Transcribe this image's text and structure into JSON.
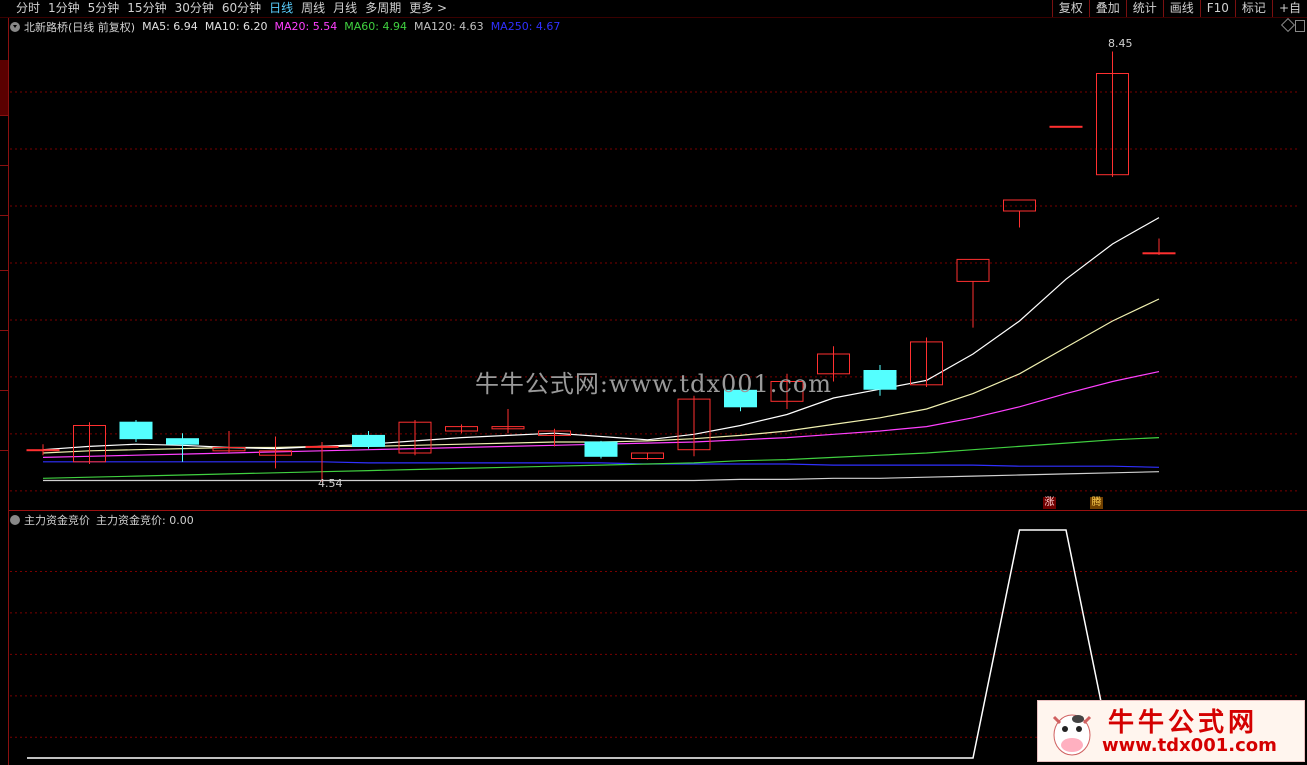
{
  "toolbar": {
    "tabs": [
      {
        "label": "分时",
        "active": false
      },
      {
        "label": "1分钟",
        "active": false
      },
      {
        "label": "5分钟",
        "active": false
      },
      {
        "label": "15分钟",
        "active": false
      },
      {
        "label": "30分钟",
        "active": false
      },
      {
        "label": "60分钟",
        "active": false
      },
      {
        "label": "日线",
        "active": true
      },
      {
        "label": "周线",
        "active": false
      },
      {
        "label": "月线",
        "active": false
      },
      {
        "label": "多周期",
        "active": false
      },
      {
        "label": "更多 >",
        "active": false
      }
    ],
    "right_buttons": [
      "复权",
      "叠加",
      "统计",
      "画线",
      "F10",
      "标记",
      "+自"
    ]
  },
  "main_legend": {
    "title": "北新路桥(日线 前复权)",
    "ma": [
      {
        "label": "MA5: 6.94",
        "color": "#e0e0e0"
      },
      {
        "label": "MA10: 6.20",
        "color": "#e0e0e0"
      },
      {
        "label": "MA20: 5.54",
        "color": "#ff40ff"
      },
      {
        "label": "MA60: 4.94",
        "color": "#40d040"
      },
      {
        "label": "MA120: 4.63",
        "color": "#c0c0c0"
      },
      {
        "label": "MA250: 4.67",
        "color": "#3030ff"
      }
    ]
  },
  "indicator_legend": {
    "name": "主力资金竞价",
    "value_label": "主力资金竞价: 0.00"
  },
  "watermark": "牛牛公式网:www.tdx001.com",
  "logo": {
    "line1": "牛牛公式网",
    "line2": "www.tdx001.com"
  },
  "badges": {
    "zhang": "涨",
    "teng": "腾"
  },
  "colors": {
    "up": "#ff3030",
    "down": "#54ffff",
    "grid": "#7a0000",
    "bg": "#000000"
  },
  "chart_data": {
    "type": "candlestick",
    "price_range": [
      4.3,
      8.6
    ],
    "high_label": "8.45",
    "low_label": "4.54",
    "candles": [
      {
        "o": 4.83,
        "h": 4.88,
        "l": 4.78,
        "c": 4.83
      },
      {
        "o": 4.72,
        "h": 5.08,
        "l": 4.7,
        "c": 5.05
      },
      {
        "o": 5.08,
        "h": 5.1,
        "l": 4.9,
        "c": 4.93
      },
      {
        "o": 4.93,
        "h": 4.98,
        "l": 4.72,
        "c": 4.88
      },
      {
        "o": 4.82,
        "h": 5.0,
        "l": 4.8,
        "c": 4.85
      },
      {
        "o": 4.78,
        "h": 4.95,
        "l": 4.66,
        "c": 4.82
      },
      {
        "o": 4.86,
        "h": 4.9,
        "l": 4.54,
        "c": 4.86
      },
      {
        "o": 4.96,
        "h": 5.0,
        "l": 4.84,
        "c": 4.86
      },
      {
        "o": 4.8,
        "h": 5.1,
        "l": 4.78,
        "c": 5.08
      },
      {
        "o": 5.0,
        "h": 5.06,
        "l": 4.98,
        "c": 5.04
      },
      {
        "o": 5.02,
        "h": 5.2,
        "l": 4.98,
        "c": 5.04
      },
      {
        "o": 4.96,
        "h": 5.02,
        "l": 4.86,
        "c": 5.0
      },
      {
        "o": 4.9,
        "h": 4.91,
        "l": 4.75,
        "c": 4.77
      },
      {
        "o": 4.75,
        "h": 4.8,
        "l": 4.74,
        "c": 4.8
      },
      {
        "o": 4.83,
        "h": 5.32,
        "l": 4.77,
        "c": 5.29
      },
      {
        "o": 5.37,
        "h": 5.43,
        "l": 5.18,
        "c": 5.22
      },
      {
        "o": 5.27,
        "h": 5.52,
        "l": 5.2,
        "c": 5.45
      },
      {
        "o": 5.52,
        "h": 5.77,
        "l": 5.45,
        "c": 5.7
      },
      {
        "o": 5.55,
        "h": 5.6,
        "l": 5.32,
        "c": 5.38
      },
      {
        "o": 5.42,
        "h": 5.85,
        "l": 5.4,
        "c": 5.81
      },
      {
        "o": 6.36,
        "h": 6.36,
        "l": 5.94,
        "c": 6.56
      },
      {
        "o": 7.0,
        "h": 7.0,
        "l": 6.85,
        "c": 7.1
      },
      {
        "o": 7.77,
        "h": 7.77,
        "l": 7.77,
        "c": 7.77
      },
      {
        "o": 7.33,
        "h": 8.45,
        "l": 7.31,
        "c": 8.25
      },
      {
        "o": 6.62,
        "h": 6.75,
        "l": 6.6,
        "c": 6.62
      }
    ],
    "ma5": [
      4.83,
      4.86,
      4.88,
      4.87,
      4.85,
      4.84,
      4.86,
      4.88,
      4.91,
      4.94,
      4.96,
      4.98,
      4.95,
      4.92,
      4.97,
      5.05,
      5.15,
      5.3,
      5.38,
      5.46,
      5.7,
      6.0,
      6.38,
      6.7,
      6.94
    ],
    "ma10": [
      4.8,
      4.82,
      4.83,
      4.84,
      4.85,
      4.85,
      4.86,
      4.86,
      4.87,
      4.88,
      4.89,
      4.9,
      4.9,
      4.91,
      4.93,
      4.96,
      5.0,
      5.06,
      5.12,
      5.2,
      5.34,
      5.52,
      5.76,
      6.0,
      6.2
    ],
    "ma20": [
      4.76,
      4.77,
      4.78,
      4.79,
      4.8,
      4.81,
      4.82,
      4.83,
      4.84,
      4.85,
      4.86,
      4.87,
      4.88,
      4.89,
      4.9,
      4.92,
      4.94,
      4.97,
      5.0,
      5.04,
      5.12,
      5.22,
      5.34,
      5.45,
      5.54
    ],
    "ma60": [
      4.57,
      4.58,
      4.59,
      4.6,
      4.61,
      4.62,
      4.63,
      4.64,
      4.65,
      4.66,
      4.67,
      4.68,
      4.69,
      4.7,
      4.71,
      4.73,
      4.74,
      4.76,
      4.78,
      4.8,
      4.83,
      4.86,
      4.89,
      4.92,
      4.94
    ],
    "ma120": [
      4.55,
      4.55,
      4.55,
      4.55,
      4.55,
      4.55,
      4.55,
      4.55,
      4.55,
      4.55,
      4.55,
      4.55,
      4.55,
      4.55,
      4.55,
      4.56,
      4.56,
      4.57,
      4.57,
      4.58,
      4.59,
      4.6,
      4.61,
      4.62,
      4.63
    ],
    "ma250": [
      4.72,
      4.72,
      4.72,
      4.72,
      4.72,
      4.72,
      4.72,
      4.71,
      4.71,
      4.71,
      4.71,
      4.71,
      4.71,
      4.7,
      4.7,
      4.7,
      4.7,
      4.69,
      4.69,
      4.69,
      4.69,
      4.68,
      4.68,
      4.68,
      4.67
    ],
    "indicator": [
      0,
      0,
      0,
      0,
      0,
      0,
      0,
      0,
      0,
      0,
      0,
      0,
      0,
      0,
      0,
      0,
      0,
      0,
      0,
      0,
      0,
      1,
      1,
      0,
      0
    ]
  }
}
